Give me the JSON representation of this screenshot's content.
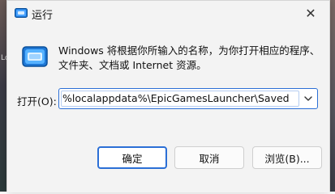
{
  "window": {
    "title": "运行",
    "close_glyph": "✕"
  },
  "content": {
    "description_line1": "Windows 将根据你所输入的名称，为你打开相应的程序、",
    "description_line2": "文件夹、文档或 Internet 资源。",
    "open_label": "打开(O):",
    "open_value": "%localappdata%\\EpicGamesLauncher\\Saved"
  },
  "buttons": {
    "ok": "确定",
    "cancel": "取消",
    "browse": "浏览(B)..."
  },
  "background": {
    "left_edge_text": "Lo"
  },
  "colors": {
    "accent": "#2b6fd6",
    "dialog_bg": "#f3f3f3",
    "text": "#111111"
  }
}
